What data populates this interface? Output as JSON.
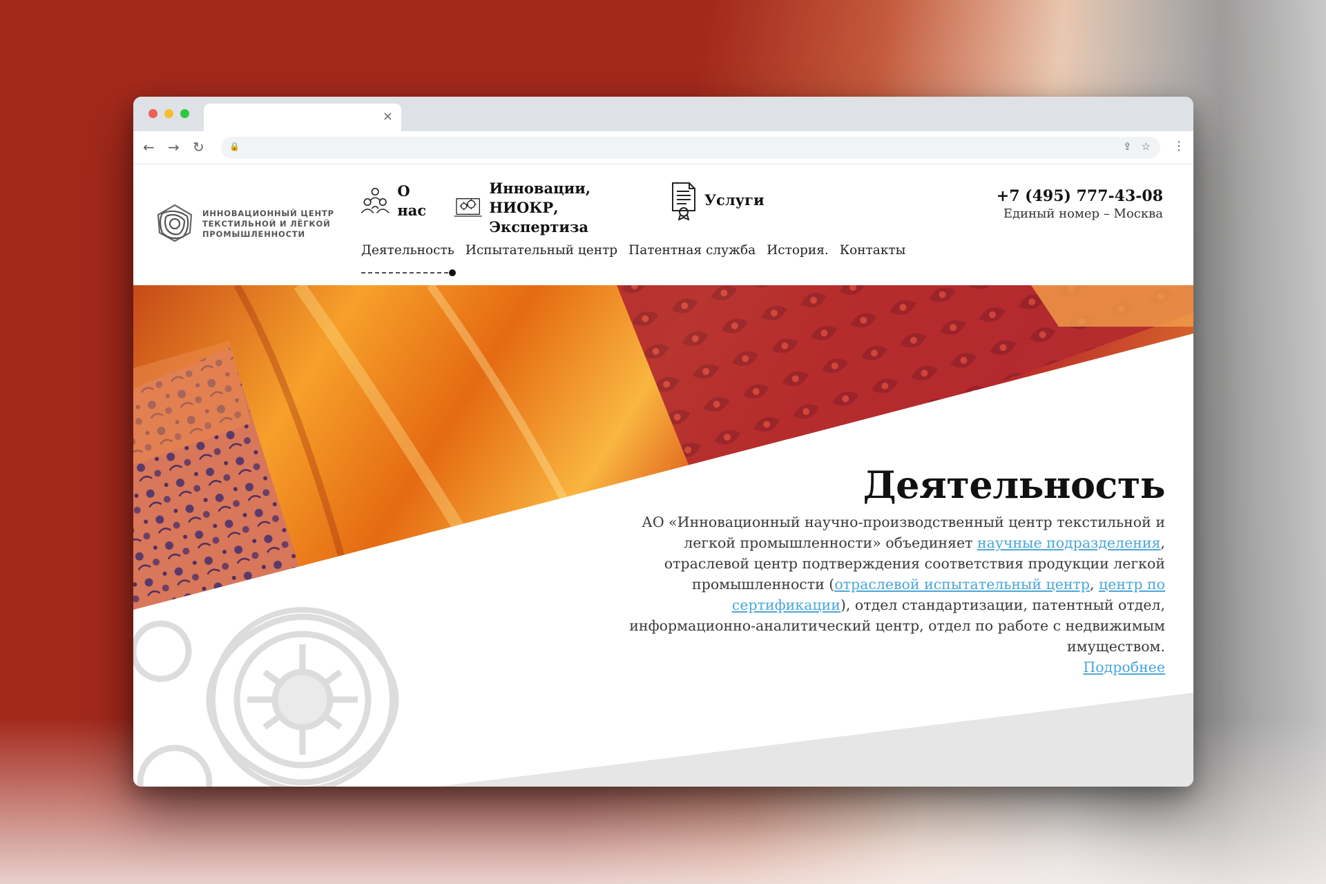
{
  "browser": {
    "tab_close": "×",
    "back": "←",
    "forward": "→",
    "reload": "↻",
    "lock": "🔒",
    "share": "⇪",
    "bookmark": "☆",
    "menu": "⋮"
  },
  "logo": {
    "lines": [
      "ИННОВАЦИОННЫЙ ЦЕНТР",
      "ТЕКСТИЛЬНОЙ И ЛЁГКОЙ",
      "ПРОМЫШЛЕННОСТИ"
    ]
  },
  "top_nav": {
    "about": {
      "label": "О нас",
      "icon": "people-icon"
    },
    "innovations": {
      "line1": "Инновации,",
      "line2": "НИОКР, Экспертиза",
      "icon": "gears-laptop-icon"
    },
    "services": {
      "label": "Услуги",
      "icon": "certificate-icon"
    }
  },
  "contact": {
    "phone": "+7 (495) 777-43-08",
    "phone_note": "Единый номер – Москва"
  },
  "sub_nav": {
    "items": [
      "Деятельность",
      "Испытательный центр",
      "Патентная служба",
      "История.",
      "Контакты"
    ],
    "active": "Деятельность"
  },
  "main": {
    "title": "Деятельность",
    "para_part1": "АО «Инновационный научно-производственный центр текстильной и легкой промышленности» объединяет ",
    "link_subdivisions": "научные подразделения",
    "para_part2": ", отраслевой центр подтверждения соответствия продукции легкой промышленности (",
    "link_testing": "отраслевой испытательный центр",
    "para_sep": ", ",
    "link_cert": "центр по сертификации",
    "para_part3": "), отдел стандартизации, патентный отдел, информационно-аналитический центр, отдел по работе с недвижимым имуществом.",
    "more_link": "Подробнее"
  },
  "colors": {
    "accent_link": "#4aa6d8",
    "fabric_orange": "#f08a1c",
    "fabric_red": "#b8262a"
  }
}
